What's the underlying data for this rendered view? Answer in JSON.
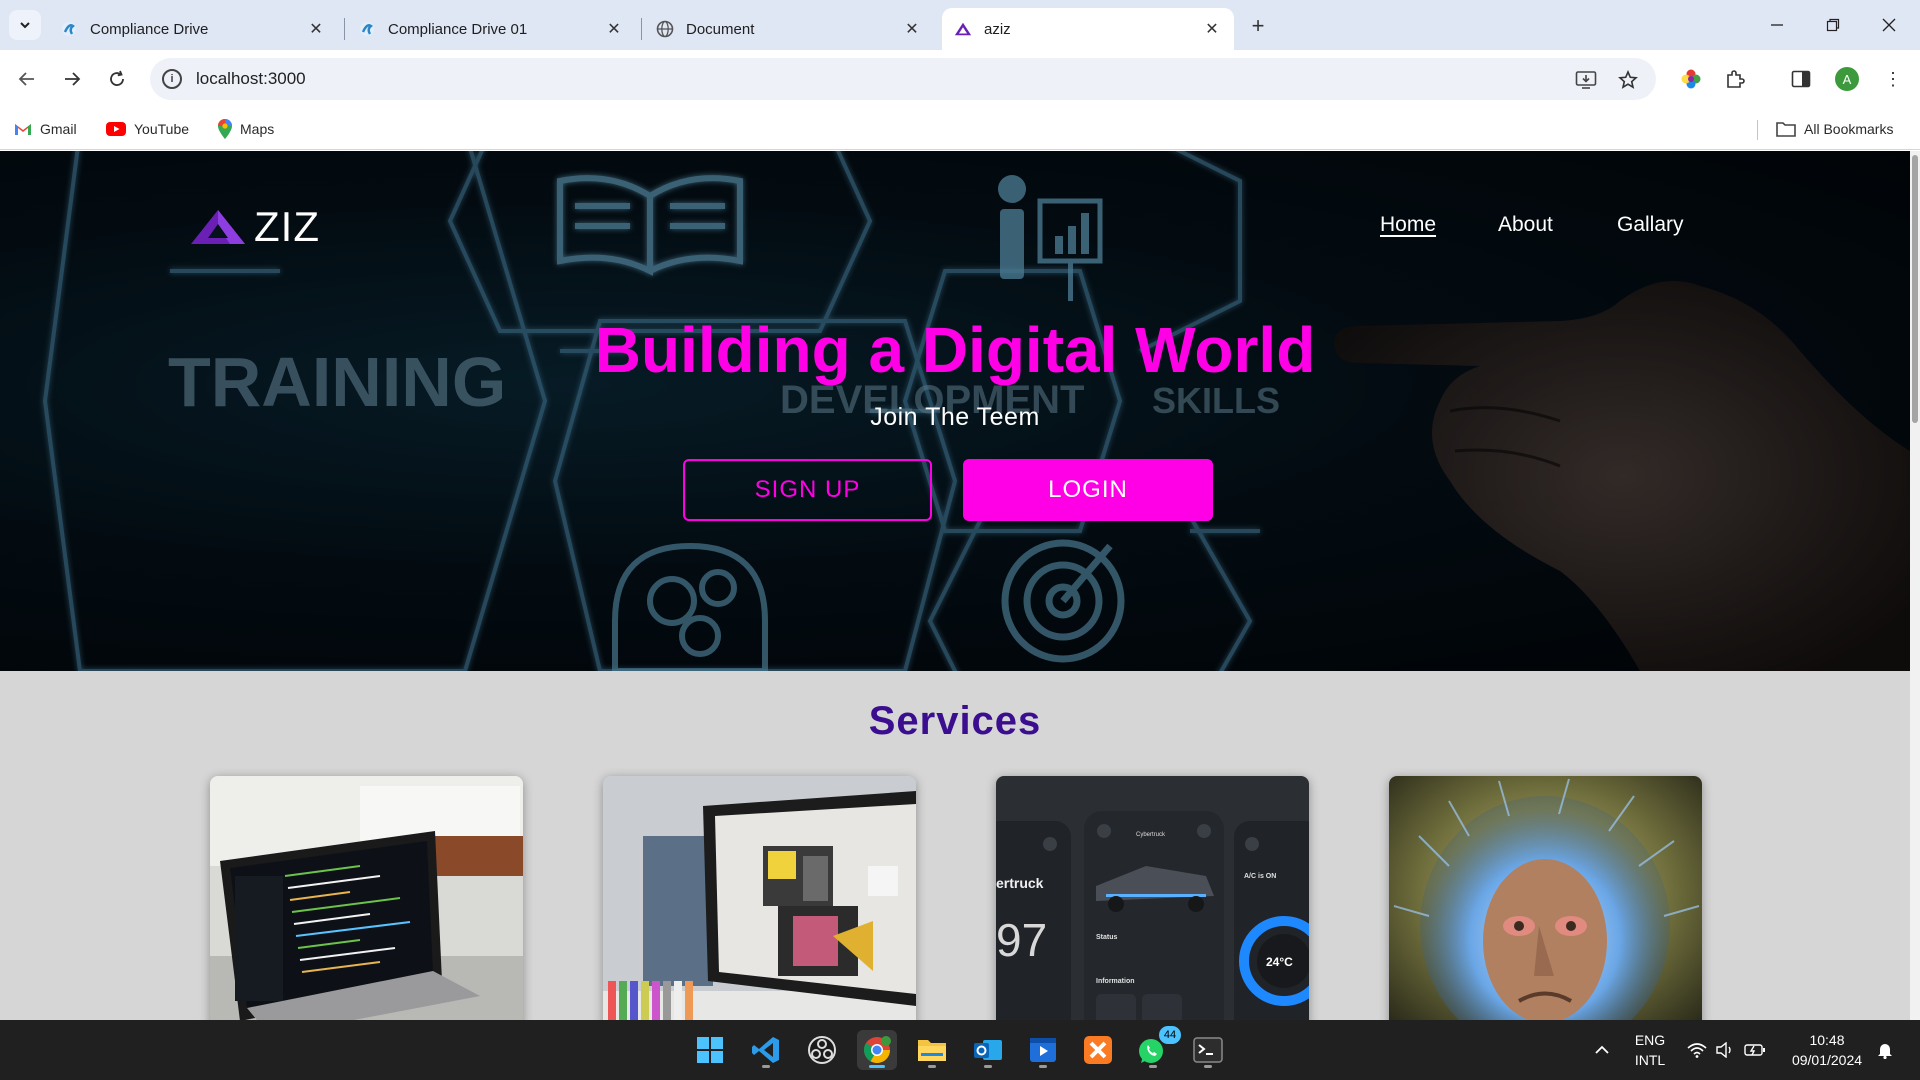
{
  "browser": {
    "tabs": [
      {
        "title": "Compliance Drive",
        "icon": "compliance-drive-icon"
      },
      {
        "title": "Compliance Drive 01",
        "icon": "compliance-drive-icon"
      },
      {
        "title": "Document",
        "icon": "globe-icon"
      },
      {
        "title": "aziz",
        "icon": "aziz-logo-icon",
        "active": true
      }
    ],
    "url": "localhost:3000",
    "bookmarks": [
      {
        "label": "Gmail",
        "icon": "gmail-icon"
      },
      {
        "label": "YouTube",
        "icon": "youtube-icon"
      },
      {
        "label": "Maps",
        "icon": "maps-icon"
      }
    ],
    "all_bookmarks_label": "All Bookmarks",
    "profile_initial": "A"
  },
  "site": {
    "logo_text": "ZIZ",
    "nav": [
      {
        "label": "Home",
        "current": true
      },
      {
        "label": "About"
      },
      {
        "label": "Gallary"
      }
    ],
    "hero": {
      "title": "Building a Digital World",
      "subtitle": "Join The Teem",
      "signup_label": "SIGN UP",
      "login_label": "LOGIN",
      "background_words": [
        "TRAINING",
        "DEVELOPMENT",
        "SKILLS"
      ]
    },
    "services_title": "Services",
    "service_cards": [
      {
        "image": "laptop-code-photo"
      },
      {
        "image": "design-monitor-photo"
      },
      {
        "image": "cybertruck-app-ui",
        "texts": [
          "ertruck",
          "97",
          "Status",
          "Information",
          "A/C is ON",
          "24°C",
          "Cybertruck"
        ]
      },
      {
        "image": "blue-hair-portrait"
      }
    ],
    "colors": {
      "accent": "#ff00e6",
      "services_title": "#3b0d8f",
      "section_bg": "#d6d6d6"
    }
  },
  "taskbar": {
    "apps": [
      "windows-start",
      "vscode",
      "obs-studio",
      "chrome",
      "file-explorer",
      "outlook",
      "media-player",
      "xampp",
      "whatsapp",
      "terminal"
    ],
    "whatsapp_badge": "44",
    "language": "ENG",
    "layout": "INTL",
    "time": "10:48",
    "date": "09/01/2024"
  }
}
